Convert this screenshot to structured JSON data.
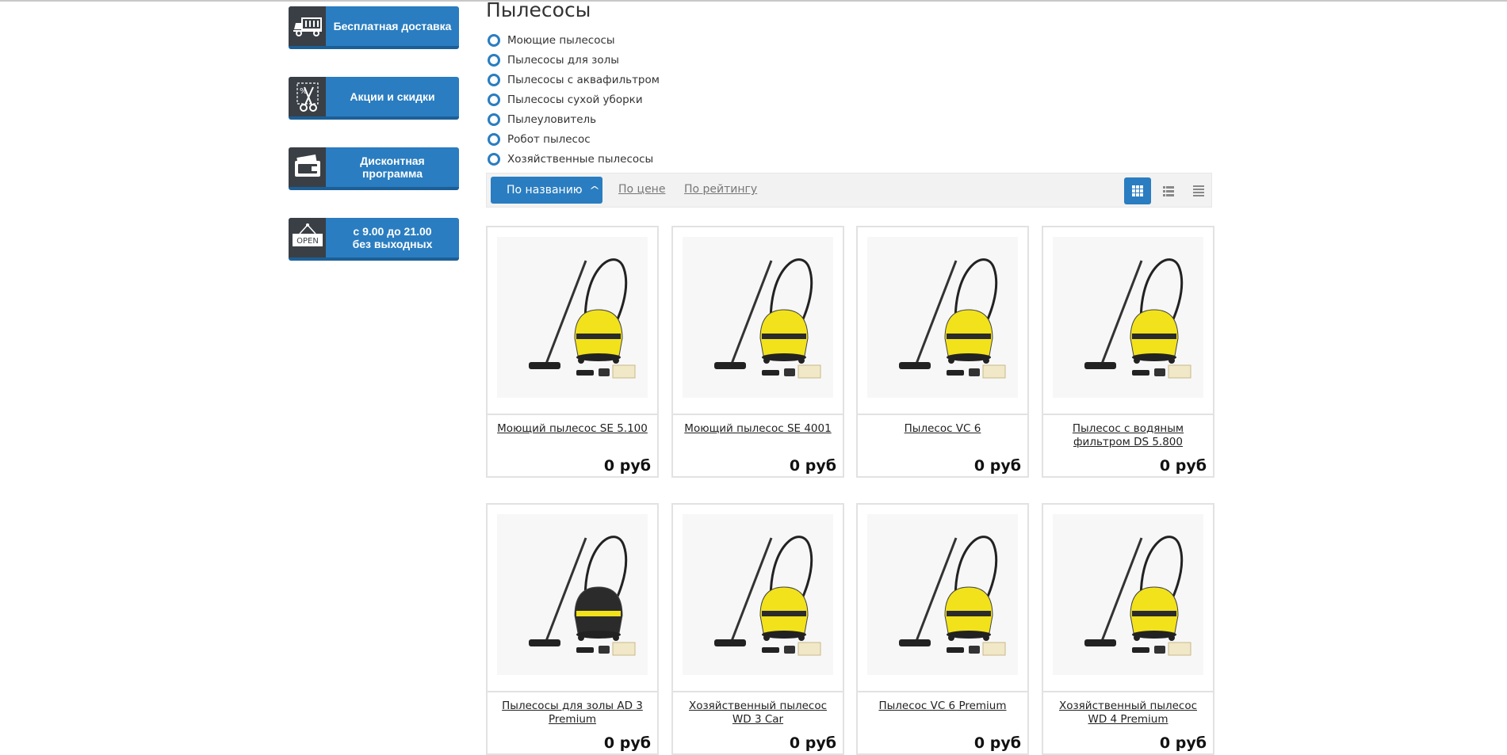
{
  "sidebar": {
    "banners": [
      {
        "label": "Бесплатная доставка",
        "icon": "truck-icon"
      },
      {
        "label": "Акции и скидки",
        "icon": "scissors-icon"
      },
      {
        "label": "Дисконтная программа",
        "icon": "wallet-icon"
      },
      {
        "label": "с 9.00 до 21.00\nбез выходных",
        "icon": "open-sign-icon",
        "icon_text": "OPEN"
      }
    ]
  },
  "category": {
    "title": "Пылесосы",
    "subcategories": [
      "Моющие пылесосы",
      "Пылесосы для золы",
      "Пылесосы с аквафильтром",
      "Пылесосы сухой уборки",
      "Пылеуловитель",
      "Робот пылесос",
      "Хозяйственные пылесосы"
    ]
  },
  "sort": {
    "active": "По названию",
    "options": [
      "По цене",
      "По рейтингу"
    ],
    "active_view": "grid"
  },
  "products": [
    {
      "name": "Моющий пылесос SE 5.100",
      "price": "0 руб",
      "body_color": "yellow"
    },
    {
      "name": "Моющий пылесос SE 4001",
      "price": "0 руб",
      "body_color": "yellow"
    },
    {
      "name": "Пылесос VC 6",
      "price": "0 руб",
      "body_color": "yellow"
    },
    {
      "name": "Пылесос с водяным фильтром DS 5.800",
      "price": "0 руб",
      "body_color": "yellow"
    },
    {
      "name": "Пылесосы для золы AD 3 Premium",
      "price": "0 руб",
      "body_color": "black"
    },
    {
      "name": "Хозяйственный пылесос WD 3 Car",
      "price": "0 руб",
      "body_color": "yellow"
    },
    {
      "name": "Пылесос VC 6 Premium",
      "price": "0 руб",
      "body_color": "yellow"
    },
    {
      "name": "Хозяйственный пылесос WD 4 Premium",
      "price": "0 руб",
      "body_color": "yellow"
    }
  ],
  "colors": {
    "accent": "#2a7dc0",
    "icon_bg": "#3a3f45",
    "product_yellow": "#f2e21b"
  }
}
